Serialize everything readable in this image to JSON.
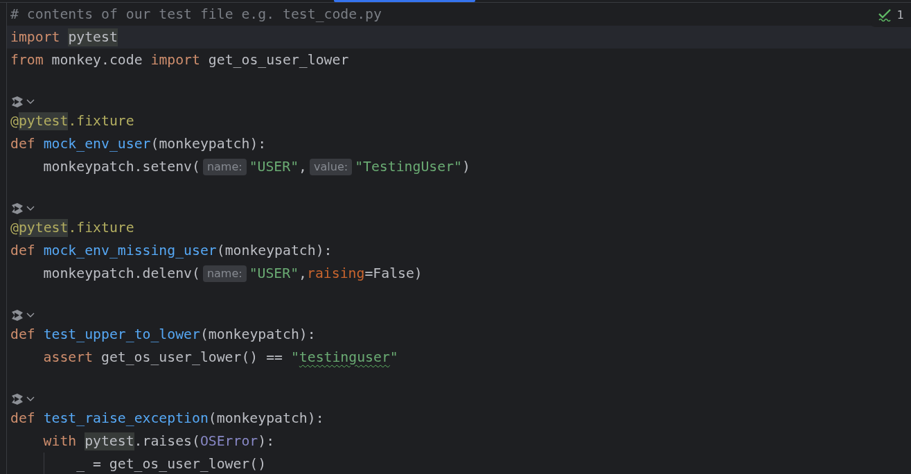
{
  "tab_strip": {
    "active_tab_marker": true
  },
  "inspection_widget": {
    "count": "1"
  },
  "lines": [
    {
      "kind": "code",
      "current": false,
      "tokens": [
        {
          "t": "# contents of our test file e.g. test_code.py",
          "kind": "comment"
        }
      ]
    },
    {
      "kind": "code",
      "current": true,
      "tokens": [
        {
          "t": "import ",
          "kind": "keyword"
        },
        {
          "t": "pytest",
          "kind": "plain",
          "usage": true
        }
      ]
    },
    {
      "kind": "code",
      "current": false,
      "tokens": [
        {
          "t": "from ",
          "kind": "keyword"
        },
        {
          "t": "monkey.code ",
          "kind": "plain"
        },
        {
          "t": "import ",
          "kind": "keyword"
        },
        {
          "t": "get_os_user_lower",
          "kind": "plain"
        }
      ]
    },
    {
      "kind": "blank"
    },
    {
      "kind": "gutter"
    },
    {
      "kind": "code",
      "current": false,
      "tokens": [
        {
          "t": "@",
          "kind": "decorator"
        },
        {
          "t": "pytest",
          "kind": "decorator",
          "usage": true
        },
        {
          "t": ".fixture",
          "kind": "decorator"
        }
      ]
    },
    {
      "kind": "code",
      "current": false,
      "tokens": [
        {
          "t": "def ",
          "kind": "keyword"
        },
        {
          "t": "mock_env_user",
          "kind": "func"
        },
        {
          "t": "(monkeypatch):",
          "kind": "plain"
        }
      ],
      "children": [
        {
          "kind": "code",
          "current": false,
          "tokens": [
            {
              "t": "monkeypatch.setenv(",
              "kind": "plain"
            },
            {
              "t": "name:",
              "kind": "hint"
            },
            {
              "t": "\"USER\"",
              "kind": "string"
            },
            {
              "t": ",",
              "kind": "plain"
            },
            {
              "t": "value:",
              "kind": "hint"
            },
            {
              "t": "\"TestingUser\"",
              "kind": "string"
            },
            {
              "t": ")",
              "kind": "plain"
            }
          ]
        }
      ]
    },
    {
      "kind": "blank"
    },
    {
      "kind": "gutter"
    },
    {
      "kind": "code",
      "current": false,
      "tokens": [
        {
          "t": "@",
          "kind": "decorator"
        },
        {
          "t": "pytest",
          "kind": "decorator",
          "usage": true
        },
        {
          "t": ".fixture",
          "kind": "decorator"
        }
      ]
    },
    {
      "kind": "code",
      "current": false,
      "tokens": [
        {
          "t": "def ",
          "kind": "keyword"
        },
        {
          "t": "mock_env_missing_user",
          "kind": "func"
        },
        {
          "t": "(monkeypatch):",
          "kind": "plain"
        }
      ],
      "children": [
        {
          "kind": "code",
          "current": false,
          "tokens": [
            {
              "t": "monkeypatch.delenv(",
              "kind": "plain"
            },
            {
              "t": "name:",
              "kind": "hint"
            },
            {
              "t": "\"USER\"",
              "kind": "string"
            },
            {
              "t": ",",
              "kind": "plain"
            },
            {
              "t": "raising",
              "kind": "kwarg"
            },
            {
              "t": "=False)",
              "kind": "plain"
            }
          ]
        }
      ]
    },
    {
      "kind": "blank"
    },
    {
      "kind": "gutter"
    },
    {
      "kind": "code",
      "current": false,
      "tokens": [
        {
          "t": "def ",
          "kind": "keyword"
        },
        {
          "t": "test_upper_to_lower",
          "kind": "func"
        },
        {
          "t": "(monkeypatch):",
          "kind": "plain"
        }
      ],
      "children": [
        {
          "kind": "code",
          "current": false,
          "tokens": [
            {
              "t": "assert ",
              "kind": "keyword"
            },
            {
              "t": "get_os_user_lower() == ",
              "kind": "plain"
            },
            {
              "t": "\"",
              "kind": "string"
            },
            {
              "t": "testinguser",
              "kind": "string",
              "typo": true
            },
            {
              "t": "\"",
              "kind": "string"
            }
          ]
        }
      ]
    },
    {
      "kind": "blank"
    },
    {
      "kind": "gutter"
    },
    {
      "kind": "code",
      "current": false,
      "tokens": [
        {
          "t": "def ",
          "kind": "keyword"
        },
        {
          "t": "test_raise_exception",
          "kind": "func"
        },
        {
          "t": "(monkeypatch):",
          "kind": "plain"
        }
      ],
      "children": [
        {
          "kind": "code",
          "current": false,
          "tokens": [
            {
              "t": "with ",
              "kind": "keyword"
            },
            {
              "t": "pytest",
              "kind": "plain",
              "usage": true
            },
            {
              "t": ".raises(",
              "kind": "plain"
            },
            {
              "t": "OSError",
              "kind": "class"
            },
            {
              "t": "):",
              "kind": "plain"
            }
          ],
          "children": [
            {
              "kind": "code",
              "current": false,
              "tokens": [
                {
                  "t": "_ = get_os_user_lower()",
                  "kind": "plain"
                }
              ]
            }
          ]
        }
      ]
    }
  ]
}
